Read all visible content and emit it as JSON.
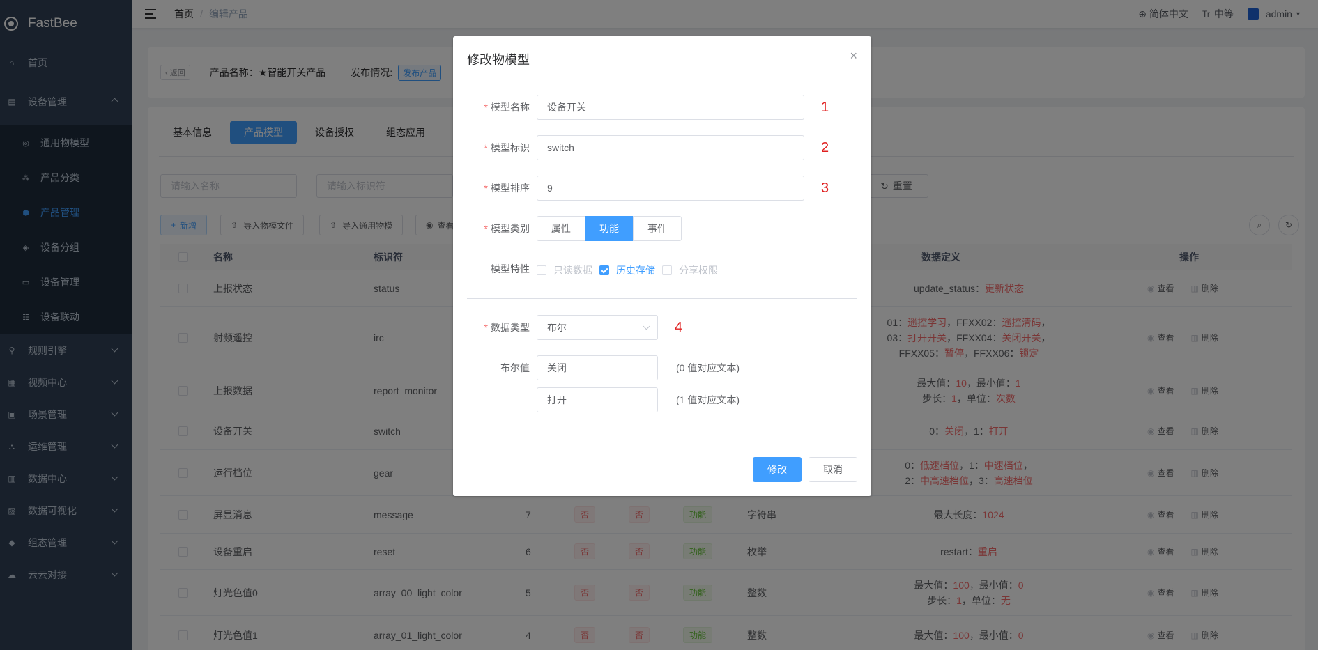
{
  "app": {
    "name": "FastBee"
  },
  "sidebar": {
    "items": [
      {
        "label": "首页",
        "icon": "home-icon"
      },
      {
        "label": "设备管理",
        "icon": "device-icon",
        "expanded": true
      },
      {
        "label": "通用物模型",
        "icon": "model-icon",
        "sub": true
      },
      {
        "label": "产品分类",
        "icon": "category-icon",
        "sub": true
      },
      {
        "label": "产品管理",
        "icon": "product-icon",
        "sub": true,
        "active": true
      },
      {
        "label": "设备分组",
        "icon": "group-icon",
        "sub": true
      },
      {
        "label": "设备管理",
        "icon": "device-list-icon",
        "sub": true
      },
      {
        "label": "设备联动",
        "icon": "linkage-icon",
        "sub": true
      },
      {
        "label": "规则引擎",
        "icon": "rule-icon"
      },
      {
        "label": "视频中心",
        "icon": "video-icon"
      },
      {
        "label": "场景管理",
        "icon": "scene-icon"
      },
      {
        "label": "运维管理",
        "icon": "ops-icon"
      },
      {
        "label": "数据中心",
        "icon": "data-icon"
      },
      {
        "label": "数据可视化",
        "icon": "visual-icon"
      },
      {
        "label": "组态管理",
        "icon": "config-icon"
      },
      {
        "label": "云云对接",
        "icon": "cloud-icon"
      }
    ]
  },
  "navbar": {
    "breadcrumb": [
      "首页",
      "编辑产品"
    ],
    "sep": "/",
    "lang": "简体中文",
    "size": "中等",
    "size_icon": "Tr",
    "user": "admin"
  },
  "product": {
    "back": "返回",
    "name": "产品名称：★智能开关产品",
    "publish_label": "发布情况:",
    "publish_tag": "发布产品"
  },
  "tabs": [
    "基本信息",
    "产品模型",
    "设备授权",
    "组态应用"
  ],
  "filters": {
    "name_placeholder": "请输入名称",
    "id_placeholder": "请输入标识符",
    "reset": "重置"
  },
  "toolbar": {
    "add": "新增",
    "import_file": "导入物模文件",
    "import_general": "导入通用物模",
    "view": "查看"
  },
  "table": {
    "headers": {
      "name": "名称",
      "id": "标识符",
      "def": "数据定义",
      "op": "操作"
    },
    "ops": {
      "view": "查看",
      "del": "删除"
    },
    "rows": [
      {
        "name": "上报状态",
        "id": "status",
        "def": [
          [
            [
              "update_status：",
              ""
            ],
            [
              "更新状态",
              "red"
            ]
          ]
        ]
      },
      {
        "name": "射频遥控",
        "id": "irc",
        "def": [
          [
            [
              "01：",
              ""
            ],
            [
              "遥控学习",
              "red"
            ],
            [
              "，FFXX02：",
              ""
            ],
            [
              "遥控清码",
              "red"
            ],
            [
              "，",
              ""
            ]
          ],
          [
            [
              "03：",
              ""
            ],
            [
              "打开开关",
              "red"
            ],
            [
              "，FFXX04：",
              ""
            ],
            [
              "关闭开关",
              "red"
            ],
            [
              "，",
              ""
            ]
          ],
          [
            [
              "FFXX05：",
              ""
            ],
            [
              "暂停",
              "red"
            ],
            [
              "，FFXX06：",
              ""
            ],
            [
              "锁定",
              "red"
            ]
          ]
        ]
      },
      {
        "name": "上报数据",
        "id": "report_monitor",
        "def": [
          [
            [
              "最大值：",
              ""
            ],
            [
              "10",
              "red"
            ],
            [
              "，最小值：",
              ""
            ],
            [
              "1",
              "red"
            ]
          ],
          [
            [
              "步长：",
              ""
            ],
            [
              "1",
              "red"
            ],
            [
              "，单位：",
              ""
            ],
            [
              "次数",
              "red"
            ]
          ]
        ]
      },
      {
        "name": "设备开关",
        "id": "switch",
        "def": [
          [
            [
              "0：",
              ""
            ],
            [
              "关闭",
              "red"
            ],
            [
              "，1：",
              ""
            ],
            [
              "打开",
              "red"
            ]
          ]
        ]
      },
      {
        "name": "运行档位",
        "id": "gear",
        "def": [
          [
            [
              "0：",
              ""
            ],
            [
              "低速档位",
              "red"
            ],
            [
              "，1：",
              ""
            ],
            [
              "中速档位",
              "red"
            ],
            [
              "，",
              ""
            ]
          ],
          [
            [
              "2：",
              ""
            ],
            [
              "中高速档位",
              "red"
            ],
            [
              "，3：",
              ""
            ],
            [
              "高速档位",
              "red"
            ]
          ]
        ]
      },
      {
        "name": "屏显消息",
        "id": "message",
        "sort": "7",
        "t1": "否",
        "t2": "否",
        "t3": "功能",
        "dt": "字符串",
        "def": [
          [
            [
              "最大长度：",
              ""
            ],
            [
              "1024",
              "red"
            ]
          ]
        ]
      },
      {
        "name": "设备重启",
        "id": "reset",
        "sort": "6",
        "t1": "否",
        "t2": "否",
        "t3": "功能",
        "dt": "枚举",
        "def": [
          [
            [
              "restart：",
              ""
            ],
            [
              "重启",
              "red"
            ]
          ]
        ]
      },
      {
        "name": "灯光色值0",
        "id": "array_00_light_color",
        "sort": "5",
        "t1": "否",
        "t2": "否",
        "t3": "功能",
        "dt": "整数",
        "def": [
          [
            [
              "最大值：",
              ""
            ],
            [
              "100",
              "red"
            ],
            [
              "，最小值：",
              ""
            ],
            [
              "0",
              "red"
            ]
          ],
          [
            [
              "步长：",
              ""
            ],
            [
              "1",
              "red"
            ],
            [
              "，单位：",
              ""
            ],
            [
              "无",
              "red"
            ]
          ]
        ]
      },
      {
        "name": "灯光色值1",
        "id": "array_01_light_color",
        "sort": "4",
        "t1": "否",
        "t2": "否",
        "t3": "功能",
        "dt": "整数",
        "def": [
          [
            [
              "最大值：",
              ""
            ],
            [
              "100",
              "red"
            ],
            [
              "，最小值：",
              ""
            ],
            [
              "0",
              "red"
            ]
          ]
        ]
      }
    ]
  },
  "dialog": {
    "title": "修改物模型",
    "close": "×",
    "fields": {
      "name": {
        "label": "模型名称",
        "value": "设备开关",
        "anno": "1"
      },
      "ident": {
        "label": "模型标识",
        "value": "switch",
        "anno": "2"
      },
      "order": {
        "label": "模型排序",
        "value": "9",
        "anno": "3"
      }
    },
    "category": {
      "label": "模型类别",
      "options": [
        "属性",
        "功能",
        "事件"
      ],
      "selected": 1
    },
    "features": {
      "label": "模型特性",
      "items": [
        {
          "label": "只读数据",
          "checked": false
        },
        {
          "label": "历史存储",
          "checked": true
        },
        {
          "label": "分享权限",
          "checked": false
        }
      ]
    },
    "datatype": {
      "label": "数据类型",
      "value": "布尔",
      "anno": "4"
    },
    "bool": {
      "label": "布尔值",
      "false_value": "关闭",
      "false_hint": "(0 值对应文本)",
      "true_value": "打开",
      "true_hint": "(1 值对应文本)"
    },
    "ok": "修改",
    "cancel": "取消"
  }
}
